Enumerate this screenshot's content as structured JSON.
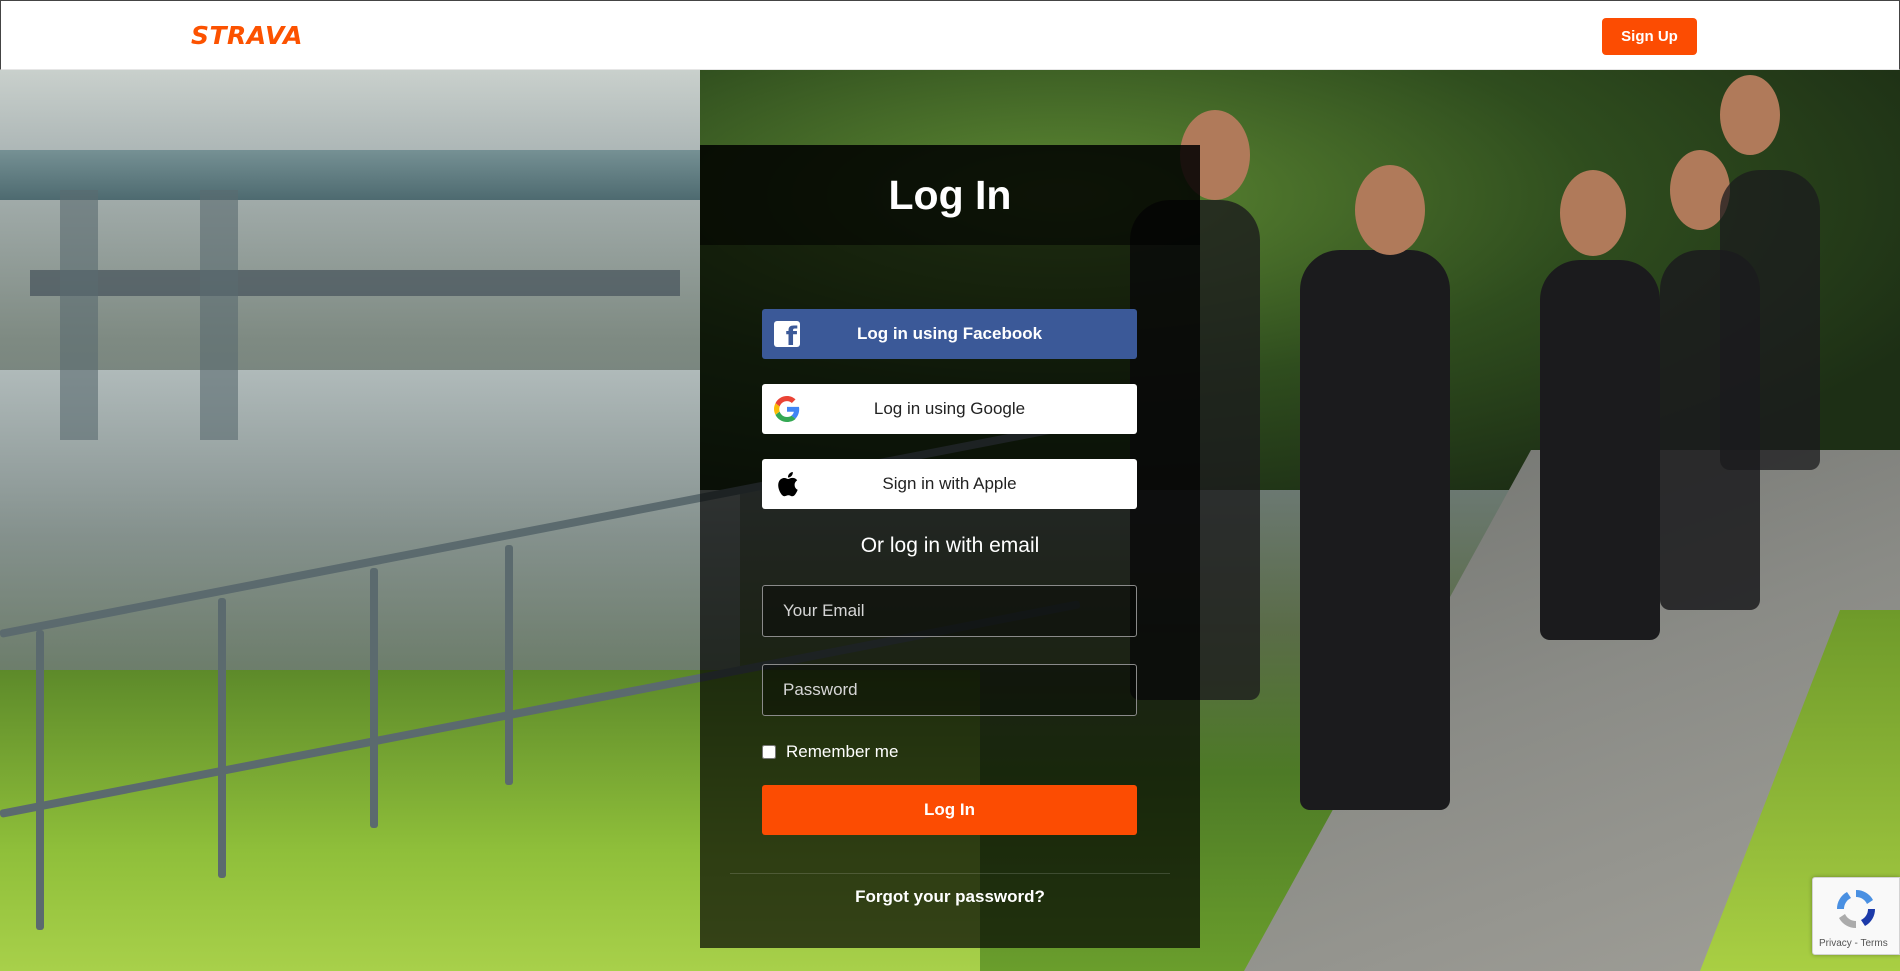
{
  "header": {
    "logo_text": "STRAVA",
    "signup_label": "Sign Up"
  },
  "login": {
    "title": "Log In",
    "facebook_label": "Log in using Facebook",
    "google_label": "Log in using Google",
    "apple_label": "Sign in with Apple",
    "divider_text": "Or log in with email",
    "email_placeholder": "Your Email",
    "password_placeholder": "Password",
    "remember_label": "Remember me",
    "submit_label": "Log In",
    "forgot_label": "Forgot your password?"
  },
  "recaptcha": {
    "links_text": "Privacy - Terms"
  },
  "colors": {
    "brand_orange": "#fc4c02",
    "facebook_blue": "#3b5998"
  }
}
